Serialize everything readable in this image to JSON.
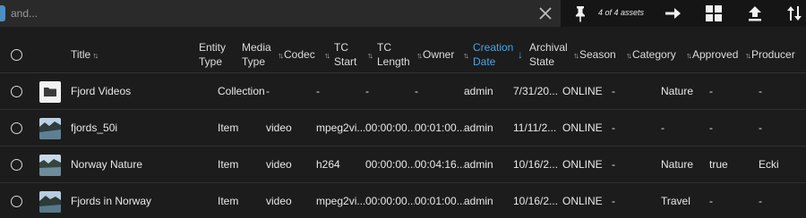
{
  "search": {
    "placeholder": "and...",
    "value": ""
  },
  "toolbar": {
    "asset_count": "4 of 4 assets",
    "icons": [
      "pin-icon",
      "arrow-right-icon",
      "grid-view-icon",
      "upload-icon",
      "sort-icon"
    ]
  },
  "colors": {
    "accent": "#4aa3df",
    "background": "#1c1c1c"
  },
  "table": {
    "headers": {
      "title": "Title",
      "entity_type_1": "Entity",
      "entity_type_2": "Type",
      "media_type_1": "Media",
      "media_type_2": "Type",
      "codec": "Codec",
      "tc_start_1": "TC",
      "tc_start_2": "Start",
      "tc_length_1": "TC",
      "tc_length_2": "Length",
      "owner": "Owner",
      "creation_date_1": "Creation",
      "creation_date_2": "Date",
      "archival_state_1": "Archival",
      "archival_state_2": "State",
      "season": "Season",
      "category": "Category",
      "approved": "Approved",
      "producer": "Producer"
    },
    "rows": [
      {
        "title": "Fjord Videos",
        "entity_type": "Collection",
        "media_type": "-",
        "codec": "-",
        "tc_start": "-",
        "tc_length": "-",
        "owner": "admin",
        "creation_date": "7/31/20...",
        "archival_state": "ONLINE",
        "season": "-",
        "category": "Nature",
        "approved": "-",
        "producer": "-"
      },
      {
        "title": "fjords_50i",
        "entity_type": "Item",
        "media_type": "video",
        "codec": "mpeg2vi...",
        "tc_start": "00:00:00...",
        "tc_length": "00:01:00...",
        "owner": "admin",
        "creation_date": "11/11/2...",
        "archival_state": "ONLINE",
        "season": "-",
        "category": "-",
        "approved": "-",
        "producer": "-"
      },
      {
        "title": "Norway Nature",
        "entity_type": "Item",
        "media_type": "video",
        "codec": "h264",
        "tc_start": "00:00:00...",
        "tc_length": "00:04:16...",
        "owner": "admin",
        "creation_date": "10/16/2...",
        "archival_state": "ONLINE",
        "season": "-",
        "category": "Nature",
        "approved": "true",
        "producer": "Ecki"
      },
      {
        "title": "Fjords in Norway",
        "entity_type": "Item",
        "media_type": "video",
        "codec": "mpeg2vi...",
        "tc_start": "00:00:00...",
        "tc_length": "00:01:00...",
        "owner": "admin",
        "creation_date": "10/16/2...",
        "archival_state": "ONLINE",
        "season": "-",
        "category": "Travel",
        "approved": "-",
        "producer": "-"
      }
    ]
  }
}
